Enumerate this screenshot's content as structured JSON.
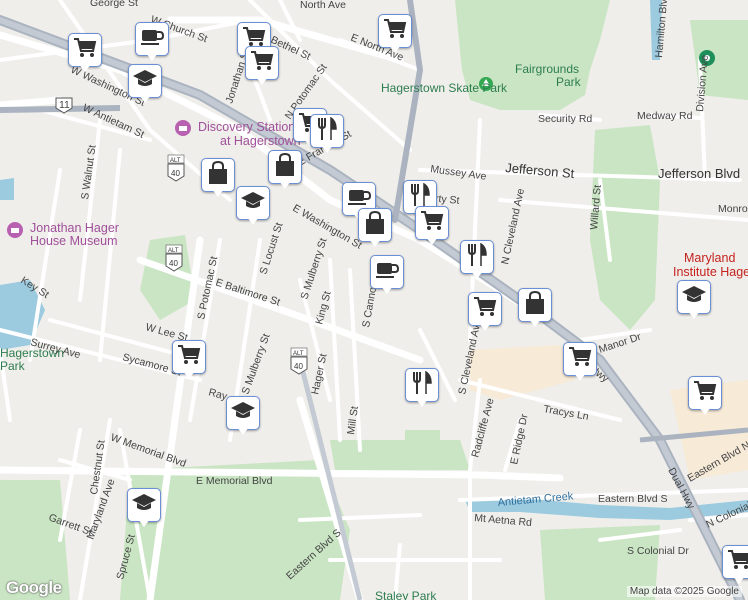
{
  "map": {
    "attribution": "Map data ©2025 Google",
    "logo": "Google",
    "colors": {
      "land": "#efeeea",
      "park": "#c9e5c3",
      "water": "#9ccbe0",
      "road": "#ffffff",
      "highway": "#aab3bf",
      "institution": "#f7ead7",
      "marker_border": "#6b8fd6"
    },
    "places": {
      "skate_park": "Hagerstown Skate Park",
      "fairgrounds": "Fairgrounds",
      "fairgrounds_2": "Park",
      "discovery": "Discovery Station",
      "discovery_2": "at Hagerstown",
      "hager_house": "Jonathan Hager",
      "hager_house_2": "House Museum",
      "maryland_inst": "Maryland",
      "maryland_inst_2": "Institute Hager",
      "city_park": "Hagerstown",
      "city_park_2": "Park",
      "staley_park": "Staley Park",
      "antietam_creek": "Antietam Creek"
    },
    "streets": {
      "george": "George St",
      "church": "W Church St",
      "north": "North Ave",
      "e_north": "E North Ave",
      "w_washington": "W Washington St",
      "bethel": "Bethel St",
      "jonathan": "Jonathan St",
      "n_potomac": "N Potomac St",
      "w_antietam": "W Antietam St",
      "s_walnut": "S Walnut St",
      "e_franklin": "E Franklin St",
      "e_washington": "E Washington St",
      "s_locust": "S Locust St",
      "s_potomac": "S Potomac St",
      "key": "Key St",
      "e_baltimore": "E Baltimore St",
      "s_mulberry": "S Mulberry St",
      "king": "King St",
      "s_cannon": "S Cannon Ave",
      "w_lee": "W Lee St",
      "surrey": "Surrey Ave",
      "sycamore": "Sycamore St",
      "hager": "Hager St",
      "mill": "Mill St",
      "s_mulberry_2": "S Mulberry St",
      "ray": "Ray",
      "chestnut": "Chestnut St",
      "w_memorial": "W Memorial Blvd",
      "maryland_ave": "Maryland Ave",
      "garrett": "Garrett St",
      "spruce": "Spruce St",
      "e_memorial": "E Memorial Blvd",
      "eastern_blvd_s": "Eastern Blvd S",
      "eastern_blvd_s2": "Eastern Blvd S",
      "eastern_blvd_n": "Eastern Blvd N",
      "mt_aetna": "Mt Aetna Rd",
      "n_colonial": "N Colonial Dr",
      "s_colonial": "S Colonial Dr",
      "tracys": "Tracys Ln",
      "radcliffe": "Radcliffe Ave",
      "e_ridge": "E Ridge Dr",
      "s_cleveland": "S Cleveland Ave",
      "n_cleveland": "N Cleveland Ave",
      "jefferson": "Jefferson St",
      "jefferson_blvd": "Jefferson Blvd",
      "mussey": "Mussey Ave",
      "liberty": "Liberty St",
      "security": "Security Rd",
      "medway": "Medway Rd",
      "division": "Division Ave",
      "willard": "Willard St",
      "monroe": "Monroe",
      "hamilton": "Hamilton Blvd",
      "manor": "Manor Dr",
      "dual_hwy": "Dual Hwy",
      "dual_hwy_2": "Dual Hwy",
      "rte11": "11",
      "alt40a": "ALT 40",
      "alt40b": "ALT 40",
      "alt40c": "ALT 40"
    },
    "markers": [
      {
        "icon": "grocery-cart-icon"
      },
      {
        "icon": "cafe-cup-icon"
      },
      {
        "icon": "grocery-cart-icon"
      },
      {
        "icon": "school-cap-icon"
      },
      {
        "icon": "grocery-cart-icon"
      },
      {
        "icon": "grocery-cart-icon"
      },
      {
        "icon": "grocery-cart-icon"
      },
      {
        "icon": "restaurant-icon"
      },
      {
        "icon": "shopping-bag-icon"
      },
      {
        "icon": "shopping-bag-icon"
      },
      {
        "icon": "school-cap-icon"
      },
      {
        "icon": "cafe-cup-icon"
      },
      {
        "icon": "restaurant-icon"
      },
      {
        "icon": "shopping-bag-icon"
      },
      {
        "icon": "grocery-cart-icon"
      },
      {
        "icon": "cafe-cup-icon"
      },
      {
        "icon": "restaurant-icon"
      },
      {
        "icon": "grocery-cart-icon"
      },
      {
        "icon": "shopping-bag-icon"
      },
      {
        "icon": "grocery-cart-icon"
      },
      {
        "icon": "grocery-cart-icon"
      },
      {
        "icon": "school-cap-icon"
      },
      {
        "icon": "restaurant-icon"
      },
      {
        "icon": "grocery-cart-icon"
      },
      {
        "icon": "school-cap-icon"
      },
      {
        "icon": "school-cap-icon"
      },
      {
        "icon": "grocery-cart-icon"
      }
    ]
  }
}
